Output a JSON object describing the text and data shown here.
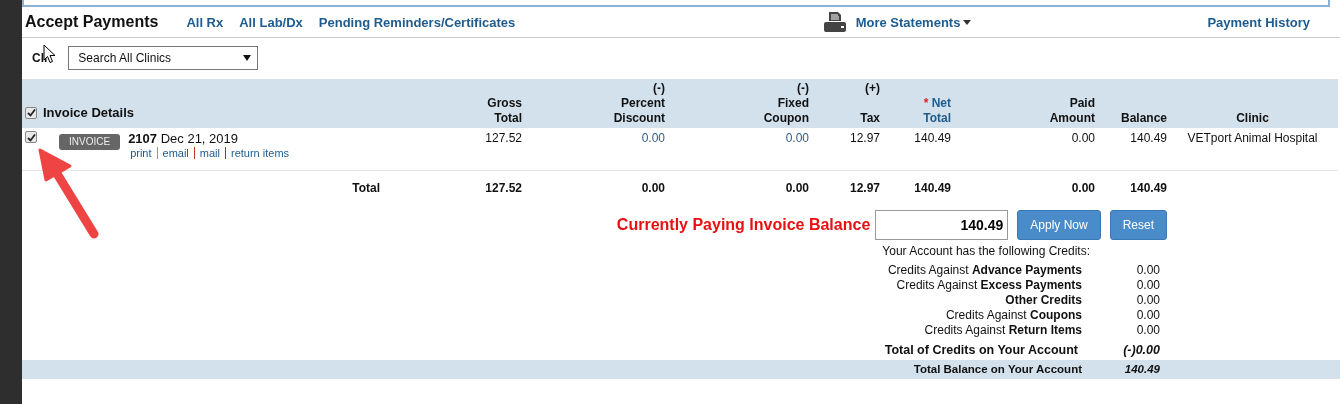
{
  "header": {
    "title": "Accept Payments",
    "links": [
      "All Rx",
      "All Lab/Dx",
      "Pending Reminders/Certificates"
    ],
    "more_menu": "More Statements",
    "history_link": "Payment History"
  },
  "clinic_filter": {
    "label": "Cli",
    "value": "Search All Clinics"
  },
  "table": {
    "select_all_checked": true,
    "columns": [
      {
        "lines": [
          "Invoice Details"
        ]
      },
      {
        "lines": [
          "Gross",
          "Total"
        ]
      },
      {
        "lines": [
          "(-)",
          "Percent",
          "Discount"
        ]
      },
      {
        "lines": [
          "(-)",
          "Fixed",
          "Coupon"
        ]
      },
      {
        "lines": [
          "(+)",
          "Tax"
        ]
      },
      {
        "mark": "*",
        "lines": [
          "Net",
          "Total"
        ]
      },
      {
        "lines": [
          "Paid",
          "Amount"
        ]
      },
      {
        "lines": [
          "Balance"
        ]
      },
      {
        "lines": [
          "Clinic"
        ]
      }
    ],
    "rows": [
      {
        "checked": true,
        "badge": "INVOICE",
        "number": "2107",
        "date": "Dec 21, 2019",
        "actions": [
          {
            "label": "print",
            "color": "#e08a1e"
          },
          {
            "label": "email",
            "color": "#c0392b"
          },
          {
            "label": "mail",
            "color": "#8e24aa"
          },
          {
            "label": "return items"
          }
        ],
        "gross": "127.52",
        "percent": "0.00",
        "coupon": "0.00",
        "tax": "12.97",
        "net": "140.49",
        "paid": "0.00",
        "balance": "140.49",
        "clinic": "VETport Animal Hospital"
      }
    ],
    "total": {
      "label": "Total",
      "gross": "127.52",
      "percent": "0.00",
      "coupon": "0.00",
      "tax": "12.97",
      "net": "140.49",
      "paid": "0.00",
      "balance": "140.49"
    }
  },
  "payment": {
    "label": "Currently Paying Invoice Balance",
    "amount": "140.49",
    "buttons": [
      "Apply Now",
      "Reset"
    ]
  },
  "credits": {
    "intro": "Your Account has the following Credits:",
    "items": [
      {
        "label": "Credits Against **Advance Payments**",
        "value": "0.00"
      },
      {
        "label": "Credits Against **Excess Payments**",
        "value": "0.00"
      },
      {
        "label": "**Other Credits**",
        "value": "0.00"
      },
      {
        "label": "Credits Against **Coupons**",
        "value": "0.00"
      },
      {
        "label": "Credits Against **Return Items**",
        "value": "0.00"
      }
    ],
    "total_credits": {
      "label": "Total of Credits on Your Account",
      "value": "(-)0.00"
    },
    "total_balance": {
      "label": "Total Balance on Your Account",
      "value": "140.49"
    }
  }
}
